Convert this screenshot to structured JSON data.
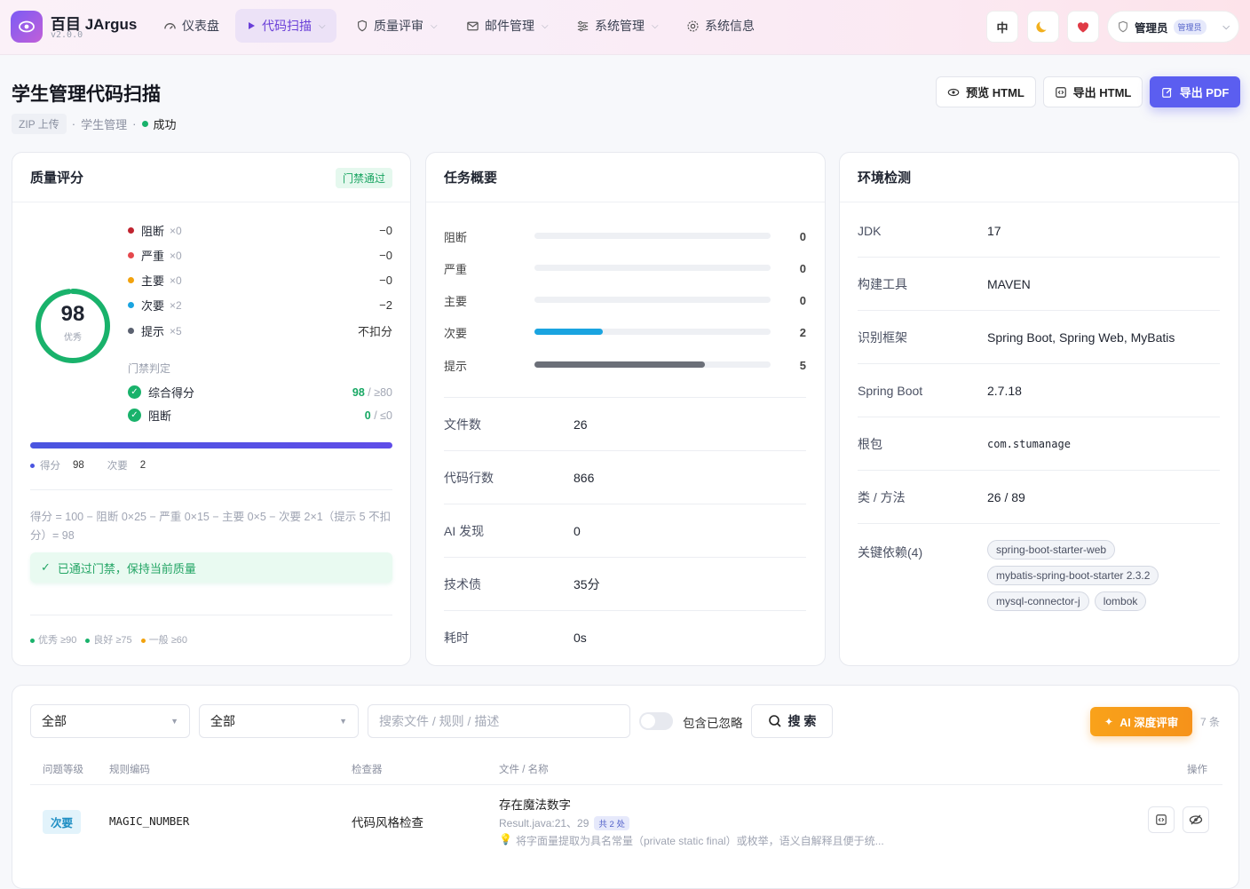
{
  "app": {
    "name": "百目 JArgus",
    "version": "v2.0.0"
  },
  "nav": [
    {
      "label": "仪表盘",
      "icon": "dashboard-icon",
      "active": false
    },
    {
      "label": "代码扫描",
      "icon": "play-icon",
      "active": true
    },
    {
      "label": "质量评审",
      "icon": "shield-icon",
      "active": false
    },
    {
      "label": "邮件管理",
      "icon": "mail-icon",
      "active": false
    },
    {
      "label": "系统管理",
      "icon": "sliders-icon",
      "active": false
    },
    {
      "label": "系统信息",
      "icon": "gear-icon",
      "active": false
    }
  ],
  "topbar": {
    "lang": "中",
    "user_name": "管理员",
    "user_role": "管理员"
  },
  "page": {
    "title": "学生管理代码扫描",
    "source_tag": "ZIP 上传",
    "project": "学生管理",
    "status": "成功"
  },
  "actions": {
    "preview": "预览 HTML",
    "export_html": "导出 HTML",
    "export_pdf": "导出 PDF"
  },
  "quality": {
    "title": "质量评分",
    "gate_badge": "门禁通过",
    "score": "98",
    "grade": "优秀",
    "severities": [
      {
        "label": "阻断",
        "count": "×0",
        "deduct": "−0",
        "color": "#c0232f"
      },
      {
        "label": "严重",
        "count": "×0",
        "deduct": "−0",
        "color": "#e5484d"
      },
      {
        "label": "主要",
        "count": "×0",
        "deduct": "−0",
        "color": "#f2a20d"
      },
      {
        "label": "次要",
        "count": "×2",
        "deduct": "−2",
        "color": "#1aa4e0"
      },
      {
        "label": "提示",
        "count": "×5",
        "deduct": "不扣分",
        "color": "#5b6170"
      }
    ],
    "gate_title": "门禁判定",
    "gates": [
      {
        "label": "综合得分",
        "value": "98",
        "threshold": "/ ≥80"
      },
      {
        "label": "阻断",
        "value": "0",
        "threshold": "/ ≤0"
      }
    ],
    "score_bar": 1.0,
    "legend": {
      "score_label": "得分",
      "score_value": "98",
      "minor_label": "次要",
      "minor_value": "2"
    },
    "formula": "得分 = 100 − 阻断 0×25 − 严重 0×15 − 主要 0×5 − 次要 2×1（提示 5 不扣分）= 98",
    "pass_msg": "已通过门禁，保持当前质量",
    "bands": [
      {
        "label": "优秀 ≥90",
        "color": "#19b26b"
      },
      {
        "label": "良好 ≥75",
        "color": "#19b26b"
      },
      {
        "label": "一般 ≥60",
        "color": "#f2a20d"
      }
    ]
  },
  "task": {
    "title": "任务概要",
    "bars": [
      {
        "label": "阻断",
        "value": "0",
        "fraction": 0,
        "color": "#c0232f"
      },
      {
        "label": "严重",
        "value": "0",
        "fraction": 0,
        "color": "#e5484d"
      },
      {
        "label": "主要",
        "value": "0",
        "fraction": 0,
        "color": "#f2a20d"
      },
      {
        "label": "次要",
        "value": "2",
        "fraction": 0.4,
        "color": "#1aa4e0"
      },
      {
        "label": "提示",
        "value": "5",
        "fraction": 1.0,
        "color": "#6b6f78"
      }
    ],
    "stats": [
      {
        "k": "文件数",
        "v": "26"
      },
      {
        "k": "代码行数",
        "v": "866"
      },
      {
        "k": "AI 发现",
        "v": "0"
      },
      {
        "k": "技术债",
        "v": "35分"
      },
      {
        "k": "耗时",
        "v": "0s"
      }
    ]
  },
  "env": {
    "title": "环境检测",
    "rows": [
      {
        "k": "JDK",
        "v": "17"
      },
      {
        "k": "构建工具",
        "v": "MAVEN"
      },
      {
        "k": "识别框架",
        "v": "Spring Boot, Spring Web, MyBatis"
      },
      {
        "k": "Spring Boot",
        "v": "2.7.18"
      },
      {
        "k": "根包",
        "v": "com.stumanage"
      },
      {
        "k": "类 / 方法",
        "v": "26 / 89"
      }
    ],
    "deps_label": "关键依赖(4)",
    "deps": [
      "spring-boot-starter-web",
      "mybatis-spring-boot-starter 2.3.2",
      "mysql-connector-j",
      "lombok"
    ]
  },
  "filters": {
    "level": "全部",
    "checker": "全部",
    "search_placeholder": "搜索文件 / 规则 / 描述",
    "include_ignored": "包含已忽略",
    "search_btn": "搜 索",
    "ai_btn": "AI 深度评审",
    "count": "7 条"
  },
  "table": {
    "headers": [
      "问题等级",
      "规则编码",
      "检查器",
      "文件 / 名称",
      "操作"
    ],
    "rows": [
      {
        "level": "次要",
        "rule": "MAGIC_NUMBER",
        "checker": "代码风格检查",
        "name": "存在魔法数字",
        "location": "Result.java:21、29",
        "occurrences": "共 2 处",
        "hint": "将字面量提取为具名常量（private static final）或枚举，语义自解释且便于统..."
      }
    ]
  }
}
